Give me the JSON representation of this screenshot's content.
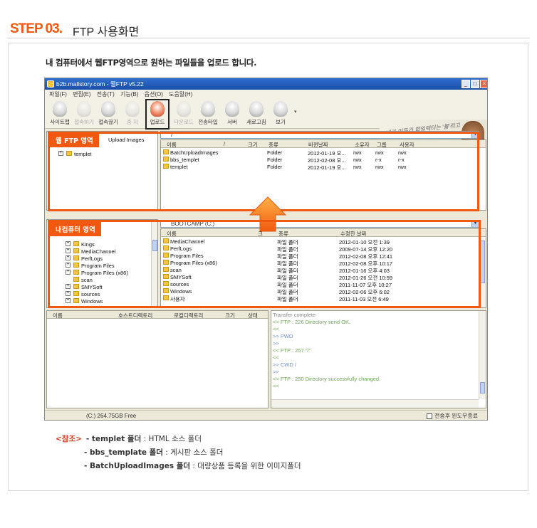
{
  "header": {
    "step": "STEP 03.",
    "title": "FTP 사용화면"
  },
  "intro": "내 컴퓨터에서 웹FTP영역으로 원하는 파일들을 업로드 합니다.",
  "app": {
    "title": "b2b.mallstory.com - 웹FTP v5.22",
    "window_buttons": [
      "_",
      "□",
      "×"
    ],
    "menu": [
      "파일(F)",
      "편집(E)",
      "전송(T)",
      "기능(B)",
      "옵션(O)",
      "도움말(H)"
    ],
    "toolbar": [
      {
        "label": "사이트맵",
        "enabled": true
      },
      {
        "label": "접속하기",
        "enabled": false
      },
      {
        "label": "접속끊기",
        "enabled": true
      },
      {
        "label": "중 지",
        "enabled": false
      },
      {
        "label": "업로드",
        "enabled": true
      },
      {
        "label": "다운로드",
        "enabled": false
      },
      {
        "label": "전송타입",
        "enabled": true
      },
      {
        "label": "서버",
        "enabled": true
      },
      {
        "label": "새로고침",
        "enabled": true
      },
      {
        "label": "보기",
        "enabled": true
      }
    ],
    "banner_text": "내가 만든건 합일렉터는 '몰'라고",
    "remote": {
      "path": "/",
      "tree": [
        "Upload Images",
        "templet"
      ],
      "columns": [
        "이름",
        "/",
        "크기",
        "종류",
        "바뀐날짜",
        "소유자",
        "그룹",
        "사용자"
      ],
      "files": [
        {
          "name": "BatchUploadImages",
          "type": "Folder",
          "date": "2012-01-19 오...",
          "owner": "rwx",
          "group": "rwx",
          "user": "rwx"
        },
        {
          "name": "bbs_templet",
          "type": "Folder",
          "date": "2012-02-08 오...",
          "owner": "rwx",
          "group": "r-x",
          "user": "r-x"
        },
        {
          "name": "templet",
          "type": "Folder",
          "date": "2012-01-19 오...",
          "owner": "rwx",
          "group": "rwx",
          "user": "rwx"
        }
      ]
    },
    "local": {
      "drive": "BOOTCAMP (C:)",
      "tree": [
        "Kings",
        "MediaChannel",
        "PerfLogs",
        "Program Files",
        "Program Files (x86)",
        "scan",
        "SMYSoft",
        "sources",
        "Windows"
      ],
      "columns": [
        "이름",
        "크",
        "종류",
        "수정한 날짜"
      ],
      "files": [
        {
          "name": "MediaChannel",
          "type": "파일 폴더",
          "date": "2012-01-10 오전 1:39"
        },
        {
          "name": "PerfLogs",
          "type": "파일 폴더",
          "date": "2009-07-14 오후 12:20"
        },
        {
          "name": "Program Files",
          "type": "파일 폴더",
          "date": "2012-02-08 오후 12:41"
        },
        {
          "name": "Program Files (x86)",
          "type": "파일 폴더",
          "date": "2012-02-08 오후 10:17"
        },
        {
          "name": "scan",
          "type": "파일 폴더",
          "date": "2012-01-16 오후 4:03"
        },
        {
          "name": "SMYSoft",
          "type": "파일 폴더",
          "date": "2012-01-26 오전 10:59"
        },
        {
          "name": "sources",
          "type": "파일 폴더",
          "date": "2011-11-07 오후 10:27"
        },
        {
          "name": "Windows",
          "type": "파일 폴더",
          "date": "2012-02-06 오후 6:02"
        },
        {
          "name": "사용자",
          "type": "파일 폴더",
          "date": "2011-11-03 오전 6:49"
        }
      ]
    },
    "queue_columns": [
      "이름",
      "호스트디렉토리",
      "로컬디렉토리",
      "크기",
      "상태"
    ],
    "log": [
      {
        "text": "Transfer complete",
        "color": "#888888"
      },
      {
        "text": "<< FTP : 226 Directory send OK.",
        "color": "#6aa84f"
      },
      {
        "text": "<<",
        "color": "#6aa84f"
      },
      {
        "text": ">> PWD",
        "color": "#6b8cc7"
      },
      {
        "text": ">>",
        "color": "#6b8cc7"
      },
      {
        "text": "<< FTP : 257 \"/\"",
        "color": "#6aa84f"
      },
      {
        "text": "<<",
        "color": "#6aa84f"
      },
      {
        "text": ">> CWD /",
        "color": "#6b8cc7"
      },
      {
        "text": ">>",
        "color": "#6b8cc7"
      },
      {
        "text": "<< FTP : 250 Directory successfully changed.",
        "color": "#6aa84f"
      },
      {
        "text": "<<",
        "color": "#6aa84f"
      }
    ],
    "status_free": "(C:)  264.75GB Free",
    "status_check": "전송후 윈도우종료"
  },
  "labels": {
    "remote": "웹 FTP 영역",
    "local": "내컴퓨터 영역"
  },
  "note": {
    "tag": "<참조>",
    "items": [
      {
        "name": "- templet 폴더",
        "desc": " : HTML 소스 폴더"
      },
      {
        "name": "- bbs_template 폴더",
        "desc": " : 게시판 소스 폴더"
      },
      {
        "name": "- BatchUploadImages 폴더",
        "desc": " : 대량상품 등록을 위한 이미지폴더"
      }
    ]
  },
  "colors": {
    "accent": "#f0590f",
    "title_bar": "#1a4ea7",
    "note_tag": "#d8371b"
  }
}
